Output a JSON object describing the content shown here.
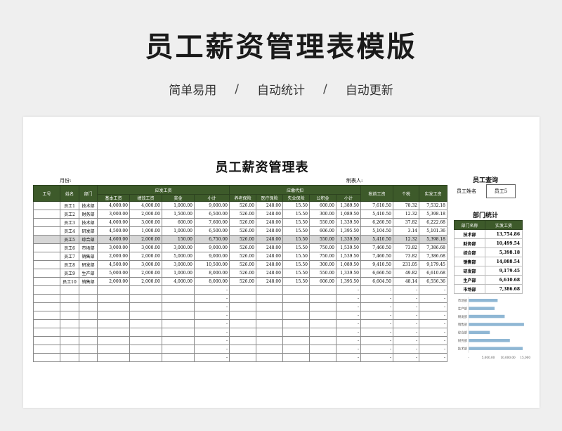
{
  "hero": {
    "title": "员工薪资管理表模版",
    "features": [
      "简单易用",
      "自动统计",
      "自动更新"
    ],
    "separator": "/"
  },
  "sheet": {
    "title": "员工薪资管理表",
    "month_label": "月份:",
    "maker_label": "制表人:",
    "headers": {
      "id": "工号",
      "name": "姓名",
      "dept": "部门",
      "payable_group": "应发工资",
      "deduct_group": "应缴代扣",
      "pretax": "税前工资",
      "tax": "个税",
      "actual": "实发工资",
      "sub": [
        "基本工资",
        "绩效工资",
        "奖金",
        "小计",
        "养老保险",
        "医疗保险",
        "失业保险",
        "公积金",
        "小计"
      ]
    },
    "rows": [
      [
        "",
        "员工1",
        "技术部",
        "4,000.00",
        "4,000.00",
        "1,000.00",
        "9,000.00",
        "526.00",
        "248.00",
        "15.50",
        "600.00",
        "1,389.50",
        "7,610.50",
        "78.32",
        "7,532.18"
      ],
      [
        "",
        "员工2",
        "财务部",
        "3,000.00",
        "2,000.00",
        "1,500.00",
        "6,500.00",
        "526.00",
        "248.00",
        "15.50",
        "300.00",
        "1,089.50",
        "5,410.50",
        "12.32",
        "5,398.18"
      ],
      [
        "",
        "员工3",
        "技术部",
        "4,000.00",
        "3,000.00",
        "600.00",
        "7,600.00",
        "526.00",
        "248.00",
        "15.50",
        "550.00",
        "1,339.50",
        "6,260.50",
        "37.82",
        "6,222.68"
      ],
      [
        "",
        "员工4",
        "研发部",
        "4,500.00",
        "1,000.00",
        "1,000.00",
        "6,500.00",
        "526.00",
        "248.00",
        "15.50",
        "606.00",
        "1,395.50",
        "5,104.50",
        "3.14",
        "5,101.36"
      ],
      [
        "",
        "员工5",
        "综合部",
        "4,600.00",
        "2,000.00",
        "150.00",
        "6,750.00",
        "526.00",
        "248.00",
        "15.50",
        "550.00",
        "1,339.50",
        "5,410.50",
        "12.32",
        "5,398.18"
      ],
      [
        "",
        "员工6",
        "市场部",
        "3,000.00",
        "3,000.00",
        "3,000.00",
        "9,000.00",
        "526.00",
        "248.00",
        "15.50",
        "750.00",
        "1,539.50",
        "7,460.50",
        "73.82",
        "7,386.68"
      ],
      [
        "",
        "员工7",
        "销售部",
        "2,000.00",
        "2,000.00",
        "5,000.00",
        "9,000.00",
        "526.00",
        "248.00",
        "15.50",
        "750.00",
        "1,539.50",
        "7,460.50",
        "73.82",
        "7,386.68"
      ],
      [
        "",
        "员工8",
        "研发部",
        "4,500.00",
        "3,000.00",
        "3,000.00",
        "10,500.00",
        "526.00",
        "248.00",
        "15.50",
        "300.00",
        "1,089.50",
        "9,410.50",
        "231.05",
        "9,179.45"
      ],
      [
        "",
        "员工9",
        "生产部",
        "5,000.00",
        "2,000.00",
        "1,000.00",
        "8,000.00",
        "526.00",
        "248.00",
        "15.50",
        "550.00",
        "1,339.50",
        "6,660.50",
        "49.82",
        "6,610.68"
      ],
      [
        "",
        "员工10",
        "销售部",
        "2,000.00",
        "2,000.00",
        "4,000.00",
        "8,000.00",
        "526.00",
        "248.00",
        "15.50",
        "606.00",
        "1,395.50",
        "6,604.50",
        "48.14",
        "6,556.36"
      ]
    ],
    "highlight_row": 4,
    "empty_rows": 9,
    "dash": "-"
  },
  "query": {
    "title": "员工查询",
    "label": "员工姓名",
    "value": "员工5"
  },
  "dept_stats": {
    "title": "部门统计",
    "headers": [
      "部门名称",
      "实发工资"
    ],
    "rows": [
      [
        "技术部",
        "13,754.86"
      ],
      [
        "财务部",
        "10,499.54"
      ],
      [
        "综合部",
        "5,398.18"
      ],
      [
        "销售部",
        "14,088.54"
      ],
      [
        "研发部",
        "9,179.45"
      ],
      [
        "生产部",
        "6,610.68"
      ],
      [
        "市场部",
        "7,386.68"
      ]
    ]
  },
  "chart_data": {
    "type": "bar",
    "orientation": "horizontal",
    "categories": [
      "市场部",
      "生产部",
      "研发部",
      "销售部",
      "综合部",
      "财务部",
      "技术部"
    ],
    "values": [
      7386.68,
      6610.68,
      9179.45,
      14088.54,
      5398.18,
      10499.54,
      13754.86
    ],
    "x_ticks": [
      "-",
      "5,000.00",
      "10,000.00",
      "15,000.00"
    ],
    "xlim": [
      0,
      15000
    ],
    "bar_color": "#8fb7d4",
    "grid": false
  },
  "colors": {
    "header_green": "#3d5a2a",
    "highlight_row": "#d6d6d6"
  }
}
